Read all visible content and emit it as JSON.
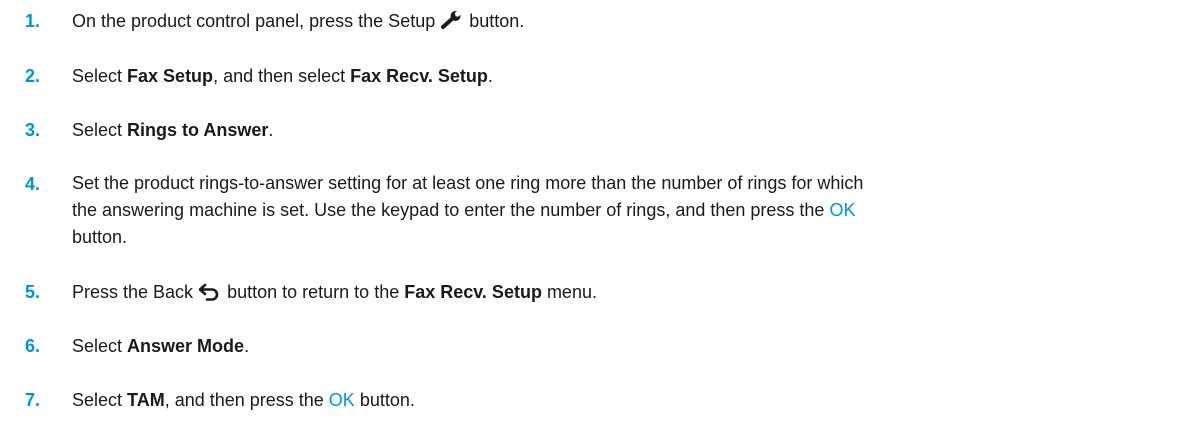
{
  "steps": [
    {
      "number": "1.",
      "before": "On the product control panel, press the Setup",
      "icon": "wrench-icon",
      "after": "button."
    },
    {
      "number": "2.",
      "t1": "Select ",
      "b1": "Fax Setup",
      "t2": ", and then select ",
      "b2": "Fax Recv. Setup",
      "t3": "."
    },
    {
      "number": "3.",
      "t1": "Select ",
      "b1": "Rings to Answer",
      "t2": "."
    },
    {
      "number": "4.",
      "line1": "Set the product rings-to-answer setting for at least one ring more than the number of rings for which",
      "line2_before": "the answering machine is set. Use the keypad to enter the number of rings, and then press the ",
      "ok": "OK",
      "line3": "button."
    },
    {
      "number": "5.",
      "before": "Press the Back",
      "icon": "back-arrow-icon",
      "middle": "button to return to the ",
      "bold": "Fax Recv. Setup",
      "after": " menu."
    },
    {
      "number": "6.",
      "t1": "Select ",
      "b1": "Answer Mode",
      "t2": "."
    },
    {
      "number": "7.",
      "t1": "Select ",
      "b1": "TAM",
      "t2": ", and then press the ",
      "ok": "OK",
      "t3": " button."
    }
  ],
  "colors": {
    "accent": "#0096d6",
    "text": "#1a1a1a"
  }
}
